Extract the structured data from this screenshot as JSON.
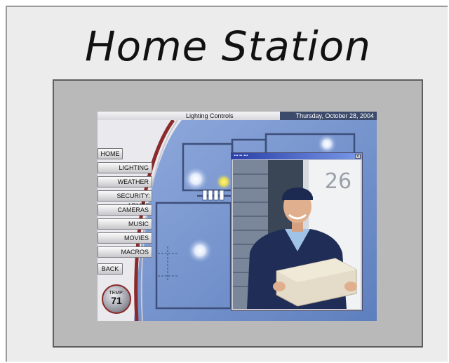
{
  "page": {
    "title": "Home Station"
  },
  "topbar": {
    "section_title": "Lighting Controls",
    "date": "Thursday, October 28, 2004"
  },
  "nav": {
    "items": [
      {
        "label": "HOME"
      },
      {
        "label": "LIGHTING"
      },
      {
        "label": "WEATHER"
      },
      {
        "label": "SECURITY: ARMED"
      },
      {
        "label": "CAMERAS"
      },
      {
        "label": "MUSIC"
      },
      {
        "label": "MOVIES"
      },
      {
        "label": "MACROS"
      },
      {
        "label": "BACK"
      }
    ]
  },
  "temperature": {
    "label": "TEMP:",
    "value": "71"
  },
  "camera_popup": {
    "house_number": "26"
  },
  "colors": {
    "floorplan_blue": "#6f8fc8",
    "accent_red": "#9a2a2a",
    "date_bar": "#3c4a6b",
    "titlebar_blue": "#2a3ea8"
  },
  "icons": {
    "close": "close-icon",
    "light": "light-bulb-icon"
  }
}
